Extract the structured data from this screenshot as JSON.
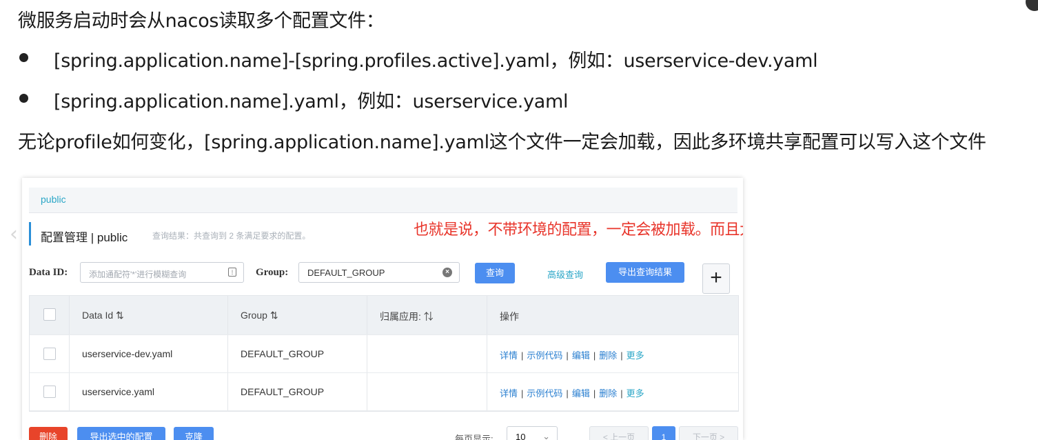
{
  "slide": {
    "heading": "微服务启动时会从nacos读取多个配置文件：",
    "bullets": [
      "[spring.application.name]-[spring.profiles.active].yaml，例如：userservice-dev.yaml",
      "[spring.application.name].yaml，例如：userservice.yaml"
    ],
    "conclusion": "无论profile如何变化，[spring.application.name].yaml这个文件一定会加载，因此多环境共享配置可以写入这个文件"
  },
  "annotation": "也就是说，不带环境的配置，一定会被加载。而且大家都能记载",
  "nacos": {
    "namespace_tab": "public",
    "page_title": "配置管理 | public",
    "result_summary": "查询结果：共查询到 2 条满足要求的配置。",
    "search": {
      "data_id_label": "Data ID:",
      "data_id_placeholder": "添加通配符'*'进行模糊查询",
      "group_label": "Group:",
      "group_value": "DEFAULT_GROUP",
      "query_button": "查询",
      "advanced_link": "高级查询",
      "export_button": "导出查询结果",
      "add_button": "+"
    },
    "table": {
      "headers": [
        "Data Id",
        "Group",
        "归属应用:",
        "操作"
      ],
      "sort_glyph": "⇅",
      "rows": [
        {
          "data_id": "userservice-dev.yaml",
          "group": "DEFAULT_GROUP",
          "app": ""
        },
        {
          "data_id": "userservice.yaml",
          "group": "DEFAULT_GROUP",
          "app": ""
        }
      ],
      "ops": {
        "detail": "详情",
        "sample": "示例代码",
        "edit": "编辑",
        "delete": "删除",
        "more": "更多",
        "sep": "|"
      }
    },
    "footer": {
      "delete_button": "删除",
      "export_selected_button": "导出选中的配置",
      "clone_button": "克隆",
      "page_size_label": "每页显示:",
      "page_size_value": "10",
      "prev_label": "< 上一页",
      "current_page": "1",
      "next_label": "下一页 >"
    }
  },
  "colors": {
    "accent_blue": "#4c8ef0",
    "link_teal": "#2aa6c7",
    "danger_red": "#e8442a",
    "annotation_red": "#e8342a"
  }
}
